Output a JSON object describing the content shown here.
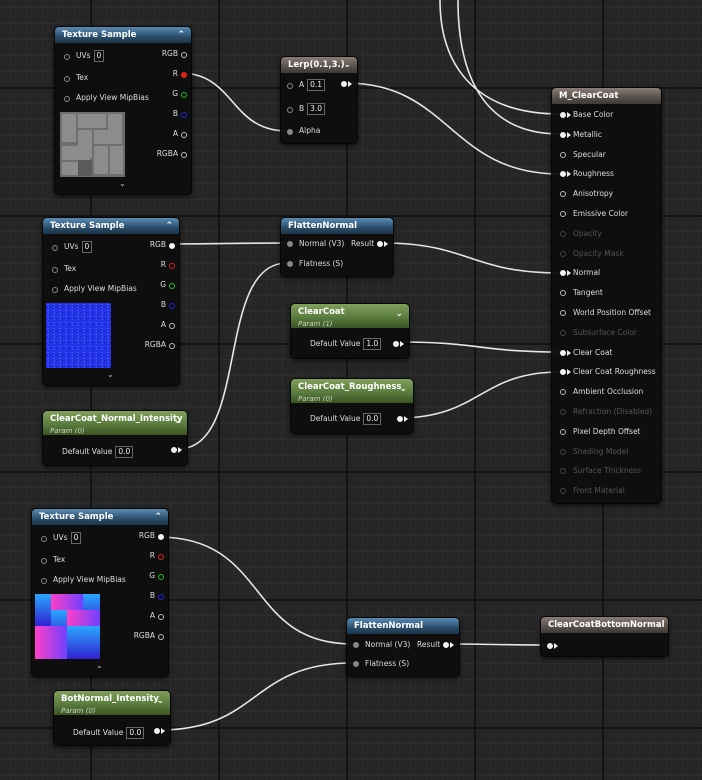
{
  "tex1": {
    "title": "Texture Sample",
    "uvs": "UVs",
    "uvs_val": "0",
    "tex": "Tex",
    "mip": "Apply View MipBias",
    "out_rgb": "RGB",
    "out_r": "R",
    "out_g": "G",
    "out_b": "B",
    "out_a": "A",
    "out_rgba": "RGBA"
  },
  "tex2": {
    "title": "Texture Sample",
    "uvs": "UVs",
    "uvs_val": "0",
    "tex": "Tex",
    "mip": "Apply View MipBias",
    "out_rgb": "RGB",
    "out_r": "R",
    "out_g": "G",
    "out_b": "B",
    "out_a": "A",
    "out_rgba": "RGBA"
  },
  "tex3": {
    "title": "Texture Sample",
    "uvs": "UVs",
    "uvs_val": "0",
    "tex": "Tex",
    "mip": "Apply View MipBias",
    "out_rgb": "RGB",
    "out_r": "R",
    "out_g": "G",
    "out_b": "B",
    "out_a": "A",
    "out_rgba": "RGBA"
  },
  "lerp": {
    "title": "Lerp(0.1,3.)",
    "a": "A",
    "a_val": "0.1",
    "b": "B",
    "b_val": "3.0",
    "alpha": "Alpha"
  },
  "flatten1": {
    "title": "FlattenNormal",
    "normal": "Normal (V3)",
    "result": "Result",
    "flatness": "Flatness (S)"
  },
  "flatten2": {
    "title": "FlattenNormal",
    "normal": "Normal (V3)",
    "result": "Result",
    "flatness": "Flatness (S)"
  },
  "clearcoat": {
    "title": "ClearCoat",
    "sub": "Param (1)",
    "label": "Default Value",
    "value": "1.0"
  },
  "cc_rough": {
    "title": "ClearCoat_Roughness",
    "sub": "Param (0)",
    "label": "Default Value",
    "value": "0.0"
  },
  "cc_normal": {
    "title": "ClearCoat_Normal_Intensity",
    "sub": "Param (0)",
    "label": "Default Value",
    "value": "0.0"
  },
  "bot_normal": {
    "title": "BotNormal_Intensity",
    "sub": "Param (0)",
    "label": "Default Value",
    "value": "0.0"
  },
  "ccbottom": {
    "title": "ClearCoatBottomNormal"
  },
  "material": {
    "title": "M_ClearCoat",
    "inputs": [
      {
        "label": "Base Color",
        "enabled": true
      },
      {
        "label": "Metallic",
        "enabled": true
      },
      {
        "label": "Specular",
        "enabled": true
      },
      {
        "label": "Roughness",
        "enabled": true
      },
      {
        "label": "Anisotropy",
        "enabled": true
      },
      {
        "label": "Emissive Color",
        "enabled": true
      },
      {
        "label": "Opacity",
        "enabled": false
      },
      {
        "label": "Opacity Mask",
        "enabled": false
      },
      {
        "label": "Normal",
        "enabled": true
      },
      {
        "label": "Tangent",
        "enabled": true
      },
      {
        "label": "World Position Offset",
        "enabled": true
      },
      {
        "label": "Subsurface Color",
        "enabled": false
      },
      {
        "label": "Clear Coat",
        "enabled": true
      },
      {
        "label": "Clear Coat Roughness",
        "enabled": true
      },
      {
        "label": "Ambient Occlusion",
        "enabled": true
      },
      {
        "label": "Refraction (Disabled)",
        "enabled": false
      },
      {
        "label": "Pixel Depth Offset",
        "enabled": true
      },
      {
        "label": "Shading Model",
        "enabled": false
      },
      {
        "label": "Surface Thickness",
        "enabled": false
      },
      {
        "label": "Front Material",
        "enabled": false
      }
    ]
  },
  "colors": {
    "wire": "#e8e8e8",
    "pin_r": "#e02020",
    "pin_g": "#20c020",
    "pin_b": "#2020e0"
  }
}
